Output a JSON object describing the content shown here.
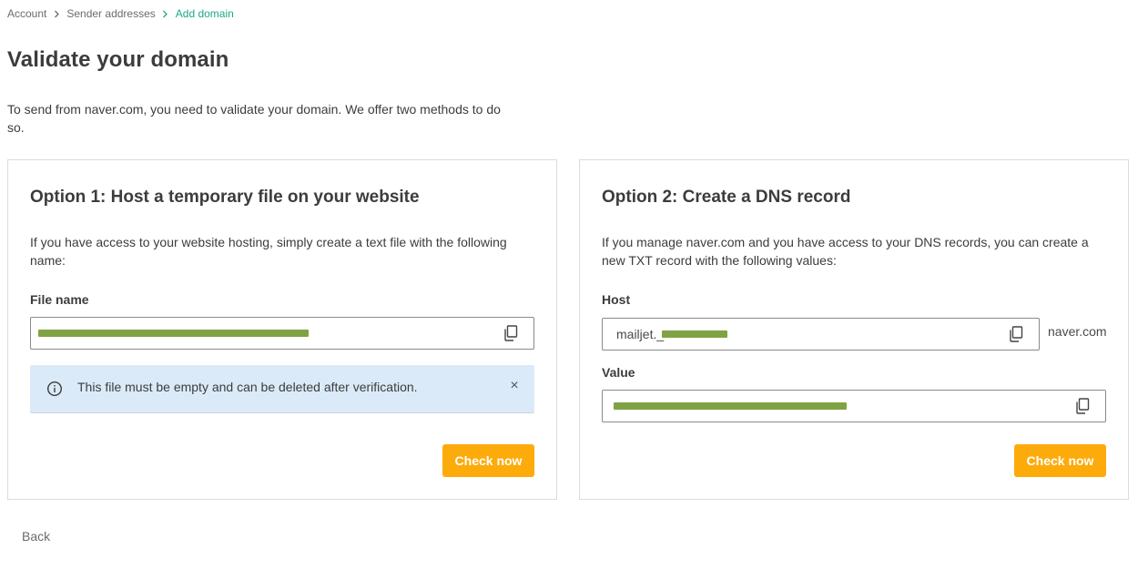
{
  "breadcrumb": {
    "items": [
      "Account",
      "Sender addresses",
      "Add domain"
    ]
  },
  "page": {
    "title": "Validate your domain",
    "intro": "To send from naver.com, you need to validate your domain. We offer two methods to do so."
  },
  "option1": {
    "title": "Option 1: Host a temporary file on your website",
    "description": "If you have access to your website hosting, simply create a text file with the following name:",
    "file_name_label": "File name",
    "file_name_value": "",
    "info_text": "This file must be empty and can be deleted after verification.",
    "close_glyph": "×",
    "check_button": "Check now"
  },
  "option2": {
    "title": "Option 2: Create a DNS record",
    "description": "If you manage naver.com and you have access to your DNS records, you can create a new TXT record with the following values:",
    "host_label": "Host",
    "host_value": "mailjet._",
    "host_suffix": "naver.com",
    "value_label": "Value",
    "value_value": "",
    "check_button": "Check now"
  },
  "footer": {
    "back": "Back"
  },
  "colors": {
    "accent_green": "#1fa883",
    "button_orange": "#fdab0b",
    "info_blue": "#dbeaf8",
    "redaction": "#7fa344"
  },
  "icons": {
    "breadcrumb_separator": "chevron-right-icon",
    "copy": "copy-icon",
    "info": "info-icon",
    "close": "close-icon"
  }
}
